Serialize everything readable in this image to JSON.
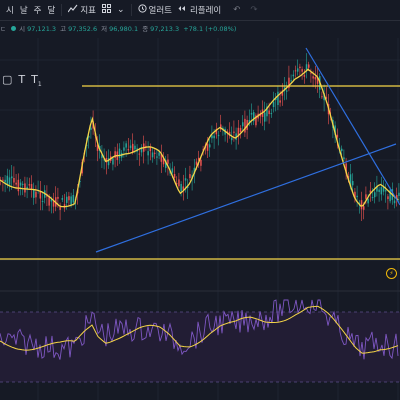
{
  "toolbar": {
    "items": [
      {
        "label": "시"
      },
      {
        "label": "날"
      },
      {
        "label": "주"
      },
      {
        "label": "달"
      },
      {
        "label": "지표",
        "icon": "indicator-icon"
      },
      {
        "label": "얼러트",
        "icon": "alert-icon"
      },
      {
        "label": "리플레이",
        "icon": "replay-icon"
      }
    ]
  },
  "legend": {
    "prefix": "ㄷ",
    "open_label": "시",
    "open": "97,121.3",
    "high_label": "고",
    "high": "97,352.6",
    "low_label": "저",
    "low": "96,980.1",
    "close_label": "종",
    "close": "97,213.3",
    "change": "+78.1 (+0.08%)"
  },
  "colors": {
    "background": "#161a25",
    "up": "#26a69a",
    "down": "#ef5350",
    "ma": "#f5d547",
    "support_resistance": "#f5d547",
    "trendline": "#2f6fe0",
    "rsi_band": "#221d34",
    "rsi_line": "#7e57c2"
  }
}
